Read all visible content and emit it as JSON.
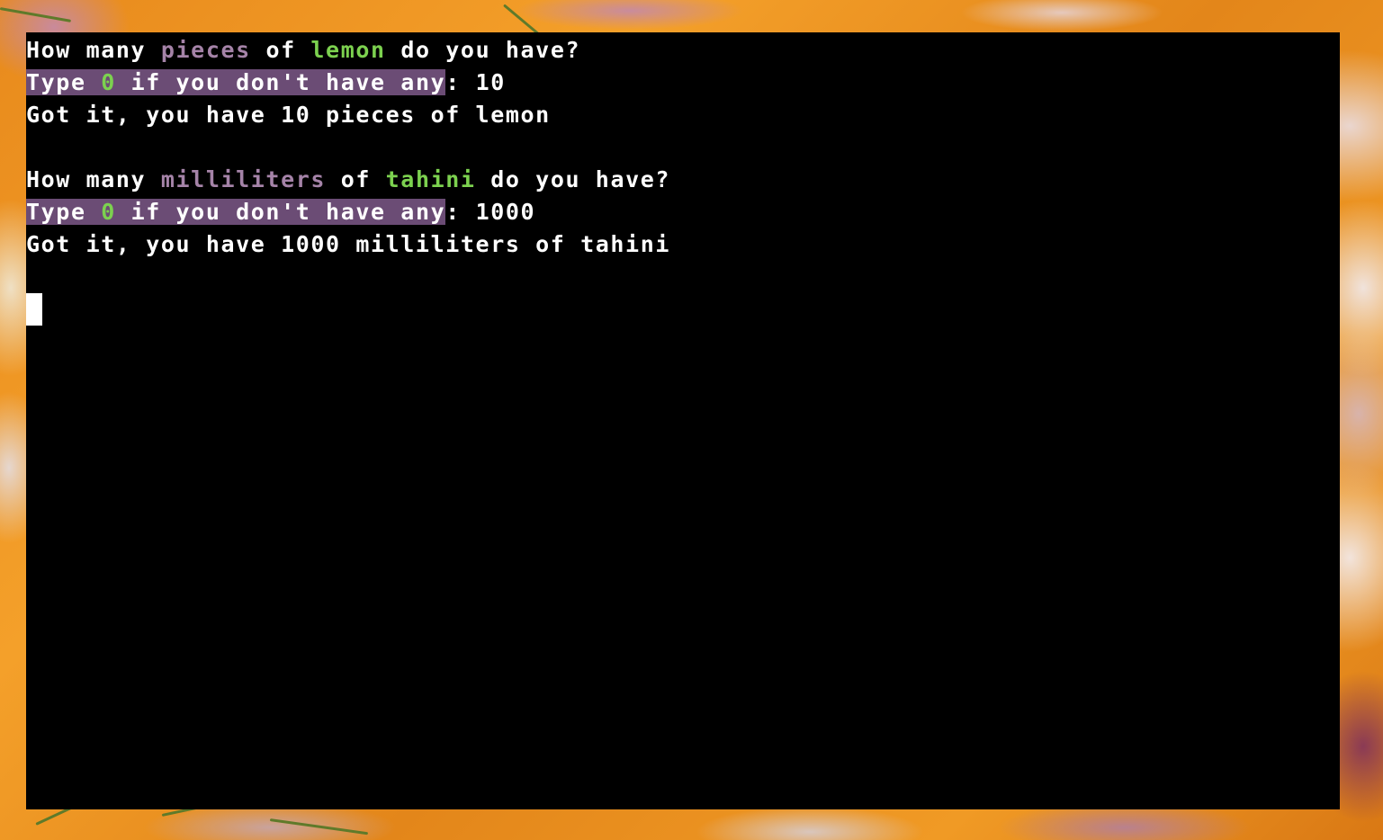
{
  "terminal": {
    "prompt1": {
      "how_many": "How many ",
      "unit": "pieces",
      "of": " of ",
      "ingredient": "lemon",
      "tail": " do you have?"
    },
    "instruction1": {
      "type": "Type ",
      "zero": "0",
      "rest": " if you don't have any",
      "colon": ": ",
      "answer": "10"
    },
    "confirm1": "Got it, you have 10 pieces of lemon",
    "prompt2": {
      "how_many": "How many ",
      "unit": "milliliters",
      "of": " of ",
      "ingredient": "tahini",
      "tail": " do you have?"
    },
    "instruction2": {
      "type": "Type ",
      "zero": "0",
      "rest": " if you don't have any",
      "colon": ": ",
      "answer": "1000"
    },
    "confirm2": "Got it, you have 1000 milliliters of tahini"
  },
  "colors": {
    "terminal_bg": "#000000",
    "text": "#ffffff",
    "unit_purple": "#a583a8",
    "ingredient_green": "#7cd14f",
    "highlight_bg": "#6b4c75"
  }
}
